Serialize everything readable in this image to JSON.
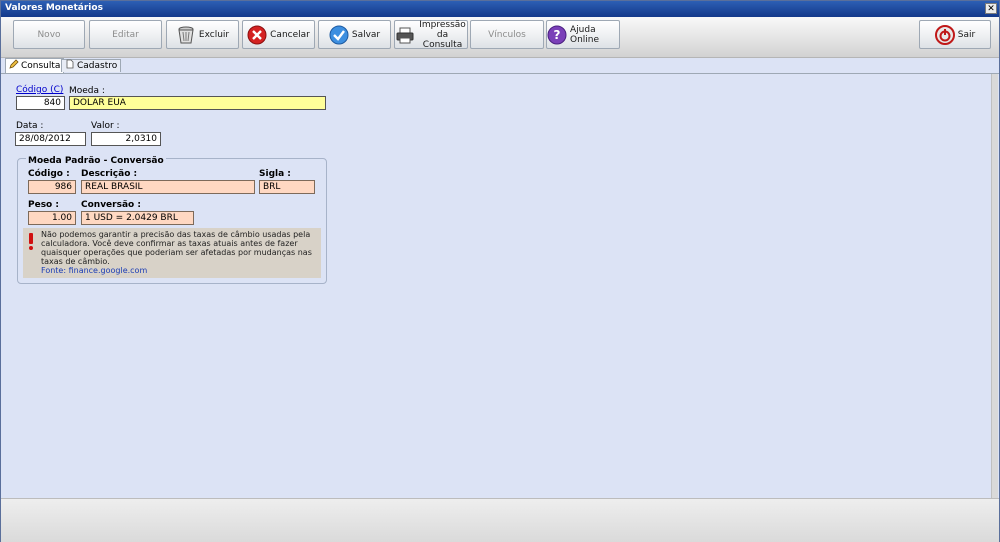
{
  "window": {
    "title": "Valores Monetários",
    "close_glyph": "✕"
  },
  "toolbar": {
    "novo": "Novo",
    "editar": "Editar",
    "excluir": "Excluir",
    "cancelar": "Cancelar",
    "salvar": "Salvar",
    "impressao_1": "Impressão",
    "impressao_2": "da Consulta",
    "vinculos": "Vínculos",
    "ajuda": "Ajuda Online",
    "sair": "Sair"
  },
  "tabs": {
    "consulta": "Consulta",
    "cadastro": "Cadastro"
  },
  "form": {
    "codigo_label": "Código (C)",
    "codigo_value": "840",
    "moeda_label": "Moeda :",
    "moeda_value": "DOLAR EUA",
    "data_label": "Data :",
    "data_value": "28/08/2012",
    "valor_label": "Valor :",
    "valor_value": "2,0310"
  },
  "conversion": {
    "title": "Moeda Padrão - Conversão",
    "codigo_label": "Código :",
    "codigo_value": "986",
    "descricao_label": "Descrição :",
    "descricao_value": "REAL BRASIL",
    "sigla_label": "Sigla :",
    "sigla_value": "BRL",
    "peso_label": "Peso :",
    "peso_value": "1.00",
    "conversao_label": "Conversão :",
    "conversao_value": "1 USD = 2.0429 BRL",
    "disclaimer": "Não podemos garantir a precisão das taxas de câmbio usadas pela calculadora. Você deve confirmar as taxas atuais antes de fazer quaisquer operações que poderiam ser afetadas por mudanças nas taxas de câmbio.",
    "source": "Fonte: finance.google.com"
  },
  "colors": {
    "title_bar": "#1f4ea0",
    "form_background": "#dce3f5",
    "highlight_field": "#ffff99",
    "readonly_field": "#ffd8c2",
    "warning_icon": "#d01010",
    "link": "#0000cc"
  },
  "icons": [
    "trash-icon",
    "cancel-icon",
    "check-icon",
    "printer-icon",
    "help-icon",
    "exit-icon",
    "pencil-icon",
    "document-icon",
    "warning-icon"
  ]
}
